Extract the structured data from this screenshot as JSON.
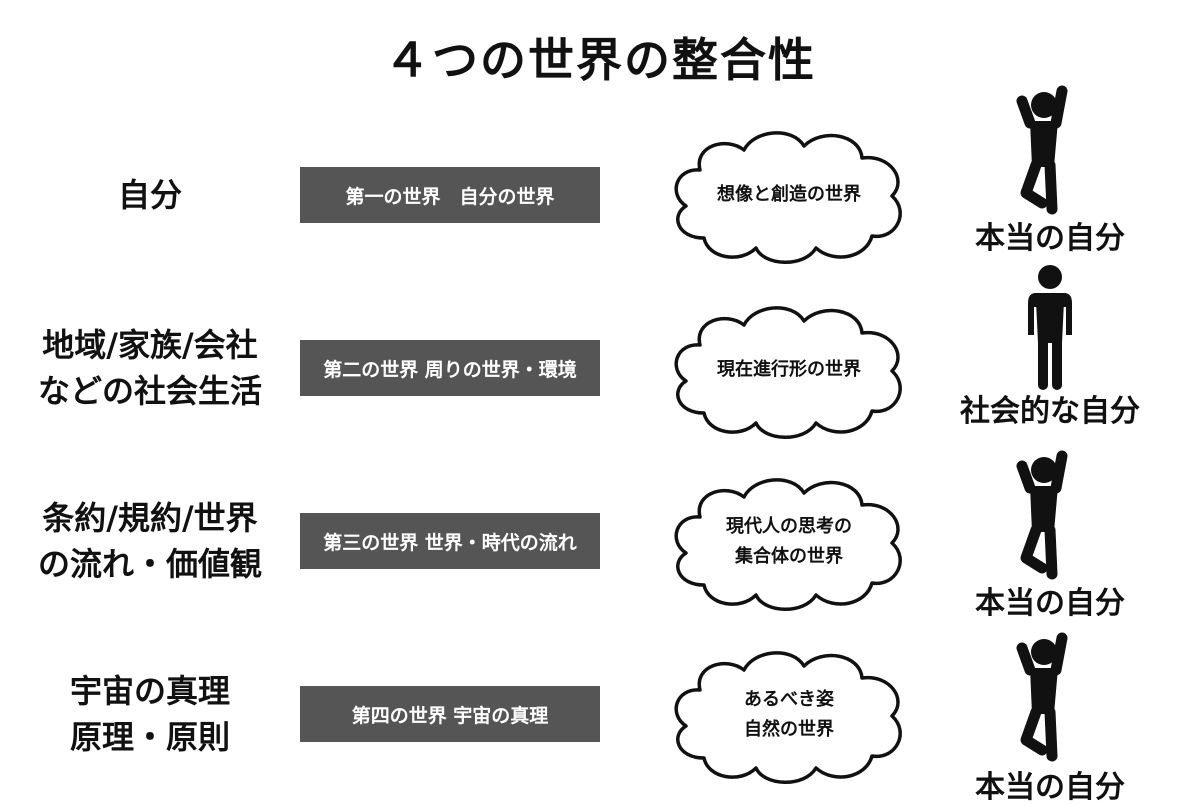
{
  "title": "４つの世界の整合性",
  "rows": [
    {
      "left": [
        "自分"
      ],
      "box": "第一の世界　自分の世界",
      "cloud": [
        "想像と創造の世界"
      ],
      "self": "本当の自分",
      "figure_icon": "person-jumping-icon"
    },
    {
      "left": [
        "地域/家族/会社",
        "などの社会生活"
      ],
      "box": "第二の世界 周りの世界・環境",
      "cloud": [
        "現在進行形の世界"
      ],
      "self": "社会的な自分",
      "figure_icon": "person-standing-icon"
    },
    {
      "left": [
        "条約/規約/世界",
        "の流れ・価値観"
      ],
      "box": "第三の世界 世界・時代の流れ",
      "cloud": [
        "現代人の思考の",
        "集合体の世界"
      ],
      "self": "本当の自分",
      "figure_icon": "person-jumping-icon"
    },
    {
      "left": [
        "宇宙の真理",
        "原理・原則"
      ],
      "box": "第四の世界 宇宙の真理",
      "cloud": [
        "あるべき姿",
        "自然の世界"
      ],
      "self": "本当の自分",
      "figure_icon": "person-jumping-icon"
    }
  ],
  "colors": {
    "box_bg": "#555555",
    "box_text": "#ffffff",
    "text": "#111111",
    "figure": "#111111"
  }
}
